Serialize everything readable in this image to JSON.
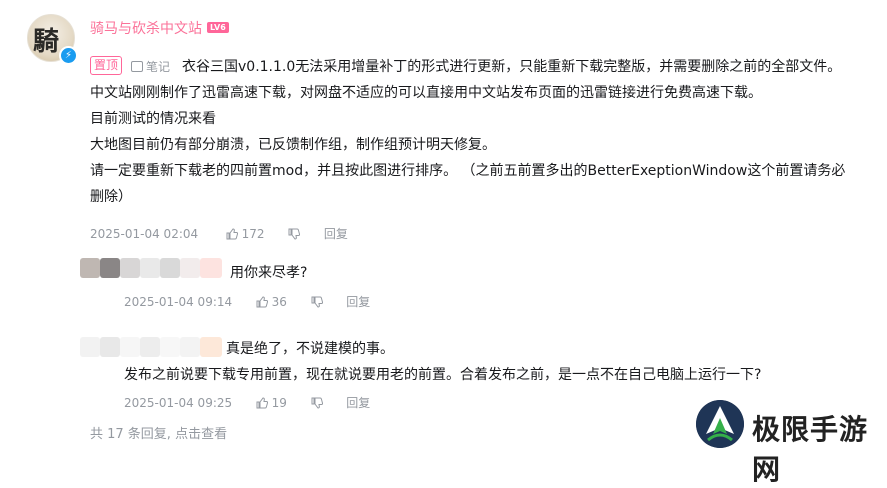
{
  "post": {
    "username": "骑马与砍杀中文站",
    "level": "LV6",
    "pin_label": "置顶",
    "note_label": "笔记",
    "lines": [
      "衣谷三国v0.1.1.0无法采用增量补丁的形式进行更新，只能重新下载完整版，并需要删除之前的全部文件。",
      "中文站刚刚制作了迅雷高速下载，对网盘不适应的可以直接用中文站发布页面的迅雷链接进行免费高速下载。",
      "目前测试的情况来看",
      "大地图目前仍有部分崩溃，已反馈制作组，制作组预计明天修复。",
      "请一定要重新下载老的四前置mod，并且按此图进行排序。  （之前五前置多出的BetterExeptionWindow这个前置请务必",
      "删除）"
    ],
    "time": "2025-01-04 02:04",
    "likes": "172",
    "reply_label": "回复"
  },
  "replies": [
    {
      "text": "用你来尽孝?",
      "time": "2025-01-04 09:14",
      "likes": "36",
      "reply_label": "回复"
    },
    {
      "text": "真是绝了，不说建模的事。",
      "text2": "发布之前说要下载专用前置，现在就说要用老的前置。合着发布之前，是一点不在自己电脑上运行一下?",
      "time": "2025-01-04 09:25",
      "likes": "19",
      "reply_label": "回复"
    }
  ],
  "footer": {
    "summary": "共 17 条回复, 点击查看"
  },
  "watermark": {
    "text": "极限手游网"
  },
  "colors": {
    "accent": "#fb7299",
    "muted": "#9499a0",
    "verify": "#1a9cf0"
  },
  "icons": [
    "avatar",
    "verified-icon",
    "note-icon",
    "thumb-up-icon",
    "thumb-down-icon",
    "watermark-logo-icon"
  ]
}
